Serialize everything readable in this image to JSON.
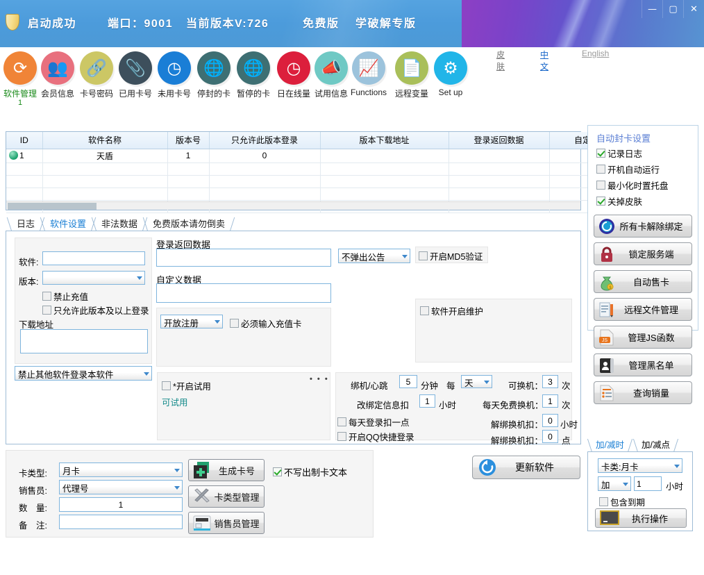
{
  "titlebar": {
    "status": "启动成功",
    "port": "端口：9001",
    "version": "当前版本V:726",
    "edition": "免费版",
    "brand": "学破解专版",
    "minimize": "—",
    "maximize": "▢",
    "close": "✕",
    "accent_blue": "#4c9bdb",
    "accent_purple": "#8d3fc4"
  },
  "toolbar": {
    "items": [
      {
        "label": "软件管理",
        "sub": "1",
        "icon": "refresh-icon",
        "color": "#f08437",
        "glyph": "⟳",
        "active": true
      },
      {
        "label": "会员信息",
        "sub": "",
        "icon": "users-icon",
        "color": "#e8707e",
        "glyph": "👥",
        "active": false
      },
      {
        "label": "卡号密码",
        "sub": "",
        "icon": "link-icon",
        "color": "#ccc765",
        "glyph": "🔗",
        "active": false
      },
      {
        "label": "已用卡号",
        "sub": "",
        "icon": "paperclip-icon",
        "color": "#3d4f5c",
        "glyph": "📎",
        "active": false
      },
      {
        "label": "未用卡号",
        "sub": "",
        "icon": "pie-chart-icon",
        "color": "#1a7ed6",
        "glyph": "◷",
        "active": false
      },
      {
        "label": "停封的卡",
        "sub": "",
        "icon": "globe-icon",
        "color": "#3e6f73",
        "glyph": "🌐",
        "active": false
      },
      {
        "label": "暂停的卡",
        "sub": "",
        "icon": "globe-icon",
        "color": "#3e6f73",
        "glyph": "🌐",
        "active": false
      },
      {
        "label": "日在线量",
        "sub": "",
        "icon": "clock-icon",
        "color": "#dc1f3c",
        "glyph": "◷",
        "active": false
      },
      {
        "label": "试用信息",
        "sub": "",
        "icon": "megaphone-icon",
        "color": "#6fc9c4",
        "glyph": "📣",
        "active": false
      },
      {
        "label": "Functions",
        "sub": "",
        "icon": "chart-line-icon",
        "color": "#9cc3dc",
        "glyph": "📈",
        "active": false
      },
      {
        "label": "远程变量",
        "sub": "",
        "icon": "document-icon",
        "color": "#a9bf5a",
        "glyph": "📄",
        "active": false
      },
      {
        "label": "Set up",
        "sub": "",
        "icon": "gear-icon",
        "color": "#21b5e8",
        "glyph": "⚙",
        "active": false
      }
    ],
    "links": [
      {
        "label": "皮肤",
        "color": "#777777"
      },
      {
        "label": "中文",
        "color": "#1464c8"
      },
      {
        "label": "English",
        "color": "#9a9a9a"
      }
    ]
  },
  "grid": {
    "columns": [
      "ID",
      "软件名称",
      "版本号",
      "只允许此版本登录",
      "版本下载地址",
      "登录返回数据",
      "自定义数"
    ],
    "rows": [
      {
        "id": "1",
        "name": "天盾",
        "ver": "1",
        "only": "0",
        "url": "",
        "ret": "",
        "custom": ""
      }
    ]
  },
  "tabs": {
    "items": [
      {
        "label": "日志",
        "selected": false
      },
      {
        "label": "软件设置",
        "selected": true
      },
      {
        "label": "非法数据",
        "selected": false
      },
      {
        "label": "免费版本请勿倒卖",
        "selected": false
      }
    ]
  },
  "software_settings": {
    "software_label": "软件:",
    "software_value": "",
    "version_label": "版本:",
    "version_value": "",
    "cb_no_recharge": "禁止充值",
    "cb_only_this_ver_up": "只允许此版本及以上登录",
    "download_label": "下载地址",
    "download_value": "",
    "forbid_other_select": "禁止其他软件登录本软件",
    "login_return_label": "登录返回数据",
    "login_return_value": "",
    "custom_data_label": "自定义数据",
    "custom_data_value": "",
    "announce_select": "不弹出公告",
    "cb_md5": "开启MD5验证",
    "register_select": "开放注册",
    "cb_must_recharge": "必须输入充值卡",
    "cb_maintenance": "软件开启维护",
    "cb_trial": "*开启试用",
    "trial_status": "可试用",
    "more_dots": "• • •"
  },
  "binding": {
    "hb_label": "绑机/心跳",
    "hb_minutes": "5",
    "hb_minutes_unit": "分钟",
    "every_label": "每",
    "every_select": "天",
    "rebind_label": "改绑定信息扣",
    "rebind_value": "1",
    "rebind_unit": "小时",
    "cb_daily_deduct": "每天登录扣一点",
    "cb_qq_login": "开启QQ快捷登录",
    "changeable_label": "可换机：",
    "changeable_value": "3",
    "changeable_unit": "次",
    "free_change_label": "每天免费换机：",
    "free_change_value": "1",
    "free_change_unit": "次",
    "unbind_hour_label": "解绑换机扣：",
    "unbind_hour_value": "0",
    "unbind_hour_unit": "小时",
    "unbind_point_label": "解绑换机扣：",
    "unbind_point_value": "0",
    "unbind_point_unit": "点"
  },
  "cardform": {
    "type_label": "卡类型:",
    "type_value": "月卡",
    "seller_label": "销售员:",
    "seller_value": "代理号",
    "qty_label": "数　量:",
    "qty_value": "1",
    "note_label": "备　注:",
    "note_value": "",
    "btn_generate": "生成卡号",
    "btn_type_manage": "卡类型管理",
    "btn_seller_manage": "销售员管理",
    "cb_no_text_out": "不写出制卡文本"
  },
  "update": {
    "label": "更新软件",
    "icon": "refresh-circle-icon"
  },
  "sidebar": {
    "title": "自动封卡设置",
    "checks": [
      {
        "label": "记录日志",
        "checked": true
      },
      {
        "label": "开机自动运行",
        "checked": false
      },
      {
        "label": "最小化时置托盘",
        "checked": false
      },
      {
        "label": "关掉皮肤",
        "checked": true
      }
    ],
    "buttons": [
      {
        "label": "所有卡解除绑定",
        "icon": "sync-circle-icon"
      },
      {
        "label": "锁定服务端",
        "icon": "lock-icon"
      },
      {
        "label": "自动售卡",
        "icon": "money-bag-icon"
      },
      {
        "label": "远程文件管理",
        "icon": "file-pencil-icon"
      },
      {
        "label": "管理JS函数",
        "icon": "js-file-icon"
      },
      {
        "label": "管理黑名单",
        "icon": "contact-book-icon"
      },
      {
        "label": "查询销量",
        "icon": "list-icon"
      }
    ]
  },
  "addtime": {
    "tabs": [
      {
        "label": "加/减时",
        "selected": true
      },
      {
        "label": "加/减点",
        "selected": false
      }
    ],
    "card_select": "卡类:月卡",
    "op_select": "加",
    "amount": "1",
    "unit": "小时",
    "cb_include_expired": "包含到期",
    "exec_button": "执行操作"
  }
}
